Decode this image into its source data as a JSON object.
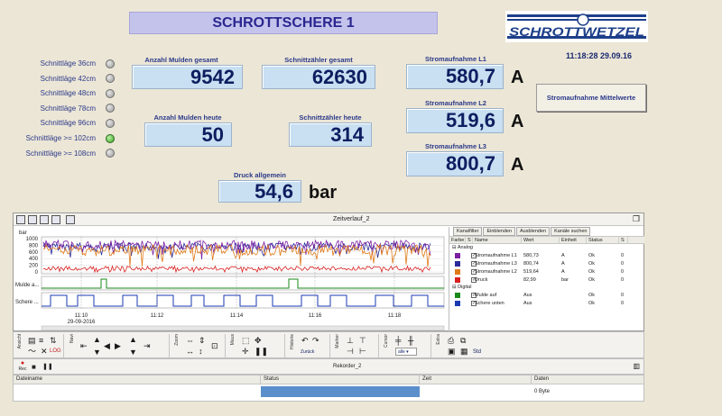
{
  "title": "SCHROTTSCHERE 1",
  "logo_text": "SCHROTTWETZEL",
  "clock": "11:18:28 29.09.16",
  "legend": [
    {
      "label": "Schnittläge 36cm",
      "on": false
    },
    {
      "label": "Schnittläge 42cm",
      "on": false
    },
    {
      "label": "Schnittläge 48cm",
      "on": false
    },
    {
      "label": "Schnittläge 78cm",
      "on": false
    },
    {
      "label": "Schnittläge 96cm",
      "on": false
    },
    {
      "label": "Schnittläge >= 102cm",
      "on": true
    },
    {
      "label": "Schnittläge >= 108cm",
      "on": false
    }
  ],
  "values": {
    "mulden_gesamt": {
      "label": "Anzahl Mulden gesamt",
      "value": "9542"
    },
    "schnitt_gesamt": {
      "label": "Schnittzähler gesamt",
      "value": "62630"
    },
    "mulden_heute": {
      "label": "Anzahl Mulden heute",
      "value": "50"
    },
    "schnitt_heute": {
      "label": "Schnittzähler heute",
      "value": "314"
    },
    "l1": {
      "label": "Stromaufnahme L1",
      "value": "580,7",
      "unit": "A"
    },
    "l2": {
      "label": "Stromaufnahme L2",
      "value": "519,6",
      "unit": "A"
    },
    "l3": {
      "label": "Stromaufnahme L3",
      "value": "800,7",
      "unit": "A"
    },
    "druck": {
      "label": "Druck allgemein",
      "value": "54,6",
      "unit": "bar"
    }
  },
  "mittelwerte_button": "Stromaufnahme Mittelwerte",
  "panel": {
    "title": "Zeitverlauf_2",
    "y_unit": "bar",
    "y_ticks": [
      "1000",
      "800",
      "600",
      "400",
      "200",
      "0"
    ],
    "digital_labels": [
      "Mulde a...",
      "Schere ..."
    ],
    "x_ticks": [
      "11:10",
      "11:12",
      "11:14",
      "11:16",
      "11:18"
    ],
    "x_date": "29-09-2016",
    "tabs": [
      "Kanalfilter",
      "Einblenden",
      "Ausblenden",
      "Kanäle suchen"
    ],
    "columns": [
      "Farbe",
      "S",
      "Name",
      "Wert",
      "Einheit",
      "Status",
      "S"
    ],
    "group_analog": "Analog",
    "group_digital": "Digital",
    "rows_analog": [
      {
        "color": "#7b1fa2",
        "name": "Stromaufnahme L1",
        "value": "580,73",
        "unit": "A",
        "status": "Ok",
        "s": "0"
      },
      {
        "color": "#2a2a9a",
        "name": "Stromaufnahme L3",
        "value": "800,74",
        "unit": "A",
        "status": "Ok",
        "s": "0"
      },
      {
        "color": "#e07a18",
        "name": "Stromaufnahme L2",
        "value": "519,64",
        "unit": "A",
        "status": "Ok",
        "s": "0"
      },
      {
        "color": "#d82020",
        "name": "Druck",
        "value": "82,99",
        "unit": "bar",
        "status": "Ok",
        "s": "0"
      }
    ],
    "rows_digital": [
      {
        "color": "#1a8a1a",
        "name": "Mulde auf",
        "value": "Aus",
        "unit": "",
        "status": "Ok",
        "s": "0"
      },
      {
        "color": "#1a3ab0",
        "name": "Schere unten",
        "value": "Aus",
        "unit": "",
        "status": "Ok",
        "s": "0"
      }
    ]
  },
  "toolbar": {
    "groups": [
      "Ansicht",
      "Navi",
      "Zoom",
      "Maus",
      "Historie",
      "Marker",
      "Cursor",
      "Extra"
    ],
    "zurueck": "Zurück",
    "cursor_select": "alle",
    "std": "Std"
  },
  "recorder": {
    "title": "Rekorder_2",
    "rec_label": "Rec",
    "columns": [
      "Dateiname",
      "Status",
      "Zeit",
      "Daten"
    ],
    "daten": "0 Byte"
  },
  "colors": {
    "l1": "#7b1fa2",
    "l2": "#e07a18",
    "l3": "#2a2a9a",
    "druck": "#d82020",
    "mulde": "#1a8a1a",
    "schere": "#1a3ab0",
    "status_bar": "#5b8fcc"
  }
}
